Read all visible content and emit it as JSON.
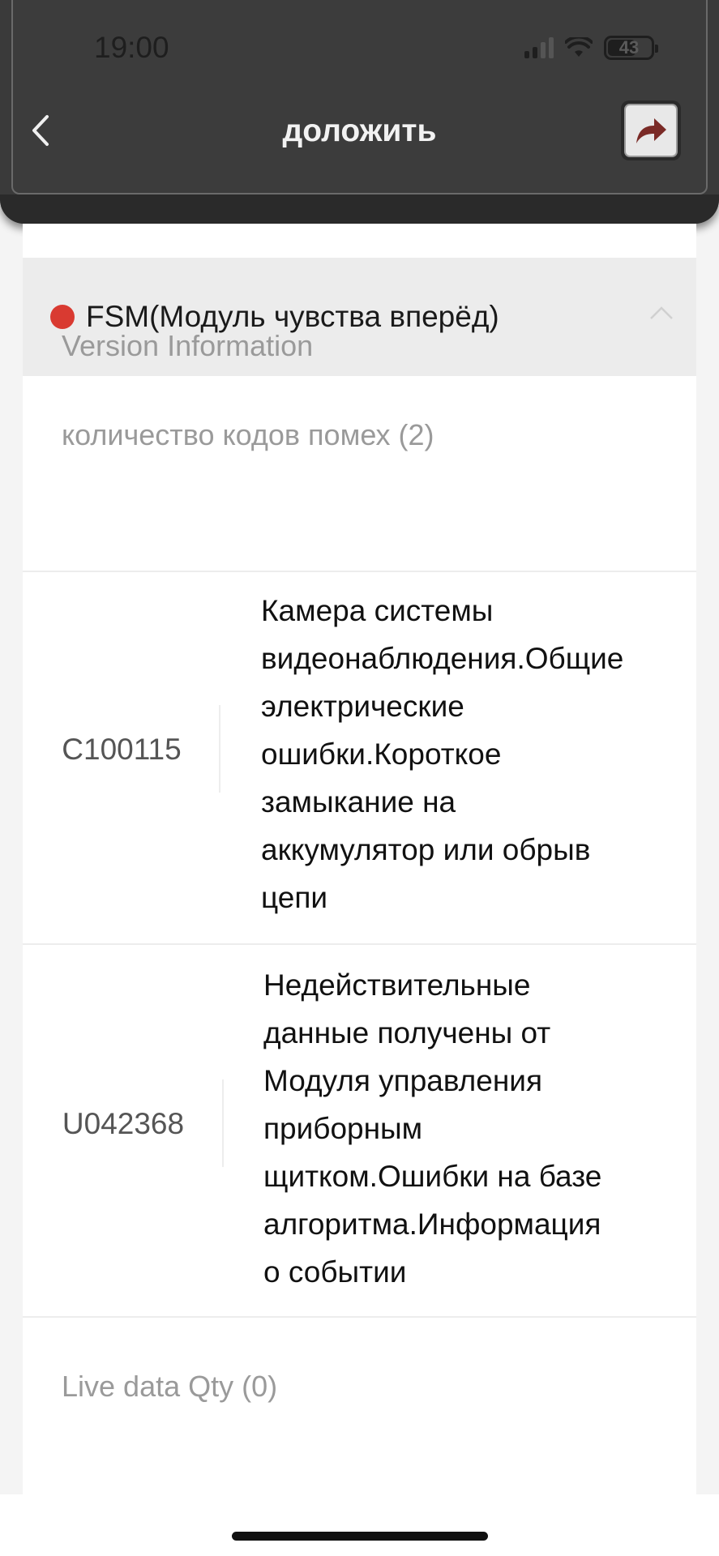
{
  "status_bar": {
    "time": "19:00",
    "battery": "43"
  },
  "header": {
    "title": "доложить"
  },
  "module": {
    "name": "FSM(Модуль чувства вперёд)",
    "status_color": "#d93a31"
  },
  "sections": {
    "version_info": "Version Information",
    "fault_codes_label": "количество кодов помех (2)",
    "live_data_label": "Live data Qty (0)"
  },
  "fault_codes": [
    {
      "code": "C100115",
      "lines": [
        "Камера системы",
        "видеонаблюдения.Общие",
        "электрические",
        "ошибки.Короткое",
        "замыкание на",
        "аккумулятор или обрыв",
        "цепи"
      ]
    },
    {
      "code": "U042368",
      "lines": [
        "Недействительные",
        "данные получены от",
        "Модуля управления",
        "приборным",
        "щитком.Ошибки на базе",
        "алгоритма.Информация",
        "о событии"
      ]
    }
  ]
}
